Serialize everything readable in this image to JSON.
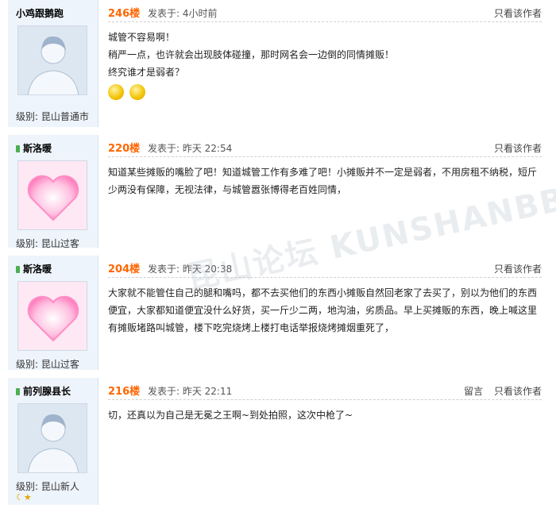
{
  "posts": [
    {
      "username": "小鸡跟鹅跑",
      "avatar": "person-avatar",
      "level": "级别: 昆山普通市",
      "floor": "246楼",
      "posted": "发表于: 4小时前",
      "actions": [
        "只看该作者"
      ],
      "lines": [
        "城管不容易啊！",
        "稍严一点，也许就会出现肢体碰撞，那时网名会一边倒的同情摊贩！",
        "终究谁才是弱者？"
      ],
      "emojis": [
        "smiley-emoji",
        "smiley-emoji"
      ]
    },
    {
      "username": "斯洛暖",
      "avatar": "heart-avatar",
      "level": "级别: 昆山过客",
      "floor": "220楼",
      "posted": "发表于: 昨天 22:54",
      "actions": [
        "只看该作者"
      ],
      "lines": [
        "知道某些摊贩的嘴脸了吧！知道城管工作有多难了吧！小摊贩并不一定是弱者，不用房租不纳税，短斤",
        "少两没有保障，无视法律，与城管嚣张博得老百姓同情，"
      ]
    },
    {
      "username": "斯洛暖",
      "avatar": "heart-avatar",
      "level": "级别: 昆山过客",
      "floor": "204楼",
      "posted": "发表于: 昨天 20:38",
      "actions": [
        "只看该作者"
      ],
      "lines": [
        "大家就不能管住自己的腿和嘴吗，都不去买他们的东西小摊贩自然回老家了去买了，别以为他们的东西",
        "便宜，大家都知道便宜没什么好货，买一斤少二两，地沟油，劣质品。早上买摊贩的东西，晚上喊这里",
        "有摊贩堵路叫城管，楼下吃完烧烤上楼打电话举报烧烤摊烟重死了，"
      ]
    },
    {
      "username": "前列腺县长",
      "avatar": "person-avatar",
      "level": "级别: 昆山新人",
      "floor": "216楼",
      "posted": "发表于: 昨天 22:11",
      "actions": [
        "留言",
        "只看该作者"
      ],
      "lines": [
        "切，还真以为自己是无冕之王啊~到处拍照，这次中枪了~"
      ],
      "badges": "moon-star-badges"
    }
  ],
  "watermark": "昆山论坛 KUNSHANBBS"
}
